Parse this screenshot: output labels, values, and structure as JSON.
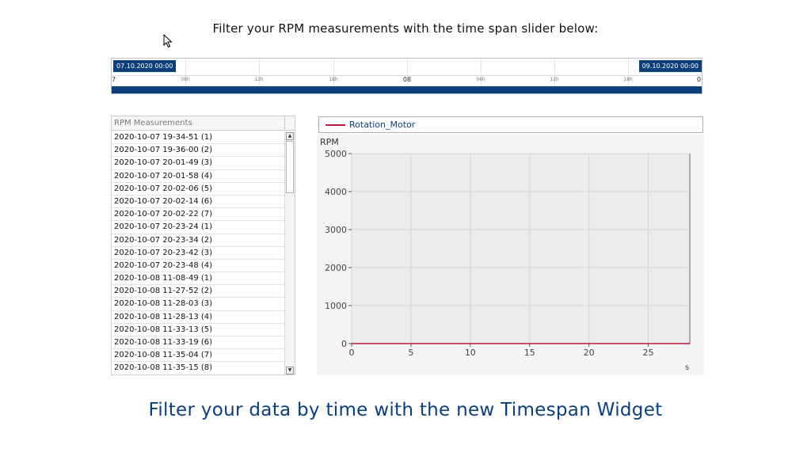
{
  "header": {
    "title": "Filter your RPM measurements with the time span slider below:"
  },
  "timespan": {
    "start_label": "07.10.2020 00:00",
    "end_label": "09.10.2020 00:00",
    "left_edge": "7",
    "right_edge": "0",
    "ticks": [
      "06h",
      "12h",
      "18h",
      "08",
      "06h",
      "12h",
      "18h"
    ],
    "major_tick": "08"
  },
  "list": {
    "header": "RPM Measurements",
    "items": [
      "2020-10-07 19-34-51 (1)",
      "2020-10-07 19-36-00 (2)",
      "2020-10-07 20-01-49 (3)",
      "2020-10-07 20-01-58 (4)",
      "2020-10-07 20-02-06 (5)",
      "2020-10-07 20-02-14 (6)",
      "2020-10-07 20-02-22 (7)",
      "2020-10-07 20-23-24 (1)",
      "2020-10-07 20-23-34 (2)",
      "2020-10-07 20-23-42 (3)",
      "2020-10-07 20-23-48 (4)",
      "2020-10-08 11-08-49 (1)",
      "2020-10-08 11-27-52 (2)",
      "2020-10-08 11-28-03 (3)",
      "2020-10-08 11-28-13 (4)",
      "2020-10-08 11-33-13 (5)",
      "2020-10-08 11-33-19 (6)",
      "2020-10-08 11-35-04 (7)",
      "2020-10-08 11-35-15 (8)"
    ],
    "scroll_up": "▲",
    "scroll_down": "▼"
  },
  "chart_data": {
    "type": "line",
    "title": "",
    "xlabel": "s",
    "ylabel": "RPM",
    "xlim": [
      0,
      28.5
    ],
    "ylim": [
      0,
      5000
    ],
    "xticks": [
      0,
      5,
      10,
      15,
      20,
      25
    ],
    "yticks": [
      0,
      1000,
      2000,
      3000,
      4000,
      5000
    ],
    "grid": true,
    "legend_position": "top",
    "series": [
      {
        "name": "Rotation_Motor",
        "color": "#c2183c",
        "x": [
          0,
          28.5
        ],
        "y": [
          0,
          0
        ]
      }
    ]
  },
  "colors": {
    "accent": "#0c3f7a",
    "series": "#c2183c",
    "plot_bg": "#ececec"
  },
  "caption": {
    "text": "Filter your data by time with the new Timespan Widget"
  }
}
